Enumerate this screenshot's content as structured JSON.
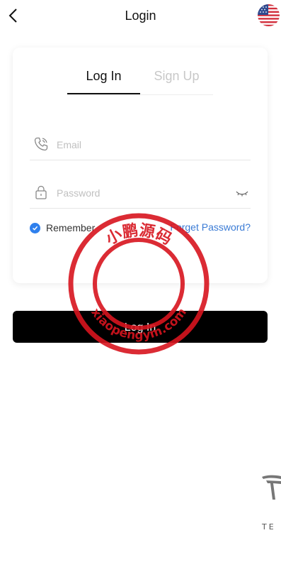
{
  "header": {
    "title": "Login",
    "language_flag": "us-flag-icon"
  },
  "tabs": [
    {
      "label": "Log In",
      "active": true
    },
    {
      "label": "Sign Up",
      "active": false
    }
  ],
  "form": {
    "email_placeholder": "Email",
    "password_placeholder": "Password",
    "remember_label": "Remember",
    "remember_checked": true,
    "forgot_label": "Forget Password?"
  },
  "submit_label": "Log In",
  "watermark": {
    "top_text": "小鹏源码",
    "bottom_text": "xiaopengym.com"
  },
  "brand": {
    "text": "TE"
  },
  "colors": {
    "accent": "#2f80ed",
    "link": "#3a7bd5",
    "button": "#000000",
    "stamp": "#d7141e"
  }
}
